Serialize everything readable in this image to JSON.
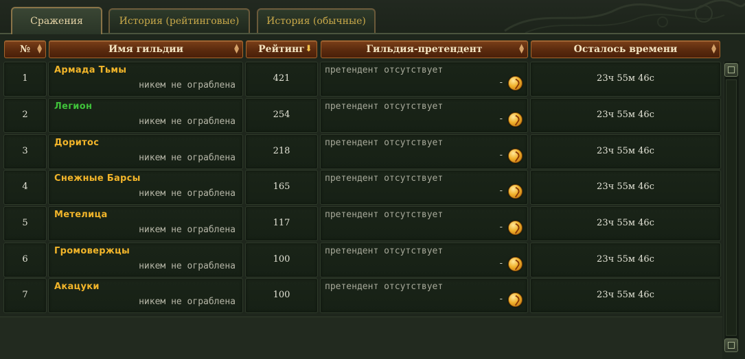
{
  "tabs": [
    {
      "label": "Сражения",
      "active": true
    },
    {
      "label": "История (рейтинговые)",
      "active": false
    },
    {
      "label": "История (обычные)",
      "active": false
    }
  ],
  "columns": {
    "num": "№",
    "name": "Имя гильдии",
    "rating": "Рейтинг",
    "candidate": "Гильдия-претендент",
    "time": "Осталось времени"
  },
  "colors": {
    "gold": "#f2b52a",
    "green": "#3fc23a",
    "header": "#6a3414"
  },
  "icons": {
    "sort": "sort-icon",
    "sort_desc": "sort-desc-icon",
    "coin": "gold-coin-icon"
  },
  "rows": [
    {
      "num": "1",
      "name": "Армада Тьмы",
      "name_color": "gold",
      "status": "никем не ограблена",
      "rating": "421",
      "candidate": "претендент отсутствует",
      "dash": "-",
      "time": "23ч 55м 46с"
    },
    {
      "num": "2",
      "name": "Легион",
      "name_color": "green",
      "status": "никем не ограблена",
      "rating": "254",
      "candidate": "претендент отсутствует",
      "dash": "-",
      "time": "23ч 55м 46с"
    },
    {
      "num": "3",
      "name": "Доритос",
      "name_color": "gold",
      "status": "никем не ограблена",
      "rating": "218",
      "candidate": "претендент отсутствует",
      "dash": "-",
      "time": "23ч 55м 46с"
    },
    {
      "num": "4",
      "name": "Снежные Барсы",
      "name_color": "gold",
      "status": "никем не ограблена",
      "rating": "165",
      "candidate": "претендент отсутствует",
      "dash": "-",
      "time": "23ч 55м 46с"
    },
    {
      "num": "5",
      "name": "Метелица",
      "name_color": "gold",
      "status": "никем не ограблена",
      "rating": "117",
      "candidate": "претендент отсутствует",
      "dash": "-",
      "time": "23ч 55м 46с"
    },
    {
      "num": "6",
      "name": "Громовержцы",
      "name_color": "gold",
      "status": "никем не ограблена",
      "rating": "100",
      "candidate": "претендент отсутствует",
      "dash": "-",
      "time": "23ч 55м 46с"
    },
    {
      "num": "7",
      "name": "Акацуки",
      "name_color": "gold",
      "status": "никем не ограблена",
      "rating": "100",
      "candidate": "претендент отсутствует",
      "dash": "-",
      "time": "23ч 55м 46с"
    }
  ]
}
